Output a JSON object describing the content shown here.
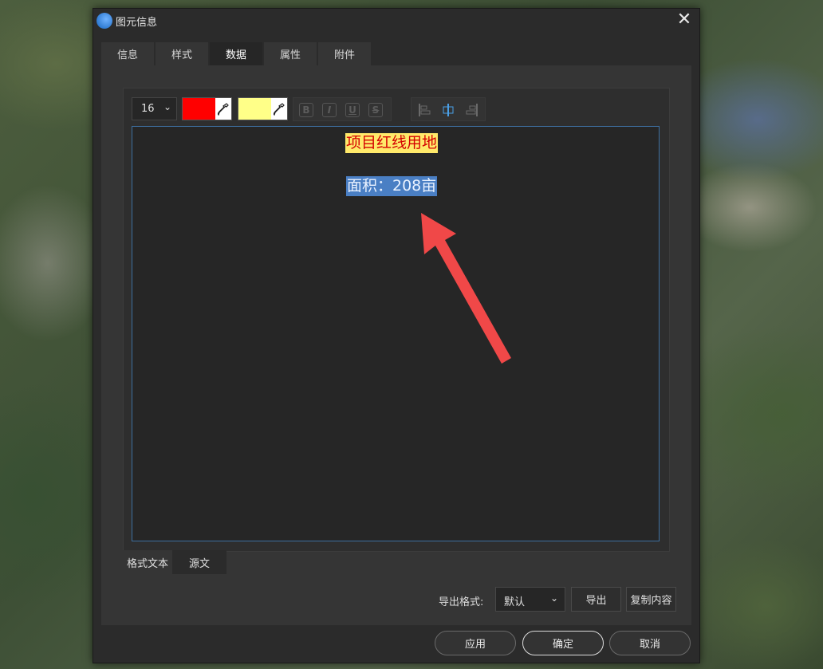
{
  "window": {
    "title": "图元信息",
    "close_symbol": "✕"
  },
  "tabs": [
    {
      "label": "信息"
    },
    {
      "label": "样式"
    },
    {
      "label": "数据"
    },
    {
      "label": "属性"
    },
    {
      "label": "附件"
    }
  ],
  "active_tab": "数据",
  "toolbar": {
    "font_size": "16",
    "text_color": "#ff0000",
    "bg_color": "#ffff88",
    "format_buttons": [
      "B",
      "I",
      "U",
      "S"
    ],
    "chevron": "⌄"
  },
  "editor": {
    "line1": "项目红线用地",
    "line2": "面积：208亩",
    "line1_color": "#d40000",
    "line1_bg": "#ffe96a",
    "line2_bg": "#4a7fc4",
    "arrow_color": "#f04848"
  },
  "bottom_tabs": [
    {
      "label": "格式文本"
    },
    {
      "label": "源文"
    }
  ],
  "export": {
    "label": "导出格式:",
    "selected": "默认",
    "export_button": "导出",
    "copy_button": "复制内容"
  },
  "footer": {
    "apply": "应用",
    "ok": "确定",
    "cancel": "取消"
  }
}
